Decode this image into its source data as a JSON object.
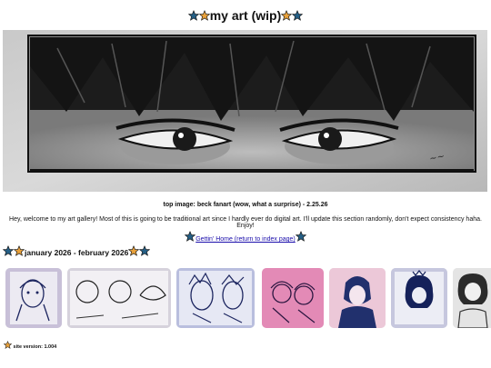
{
  "page": {
    "title": "my art (wip)",
    "caption": "top image: beck fanart (wow, what a surprise) - 2.25.26",
    "intro": "Hey, welcome to my art gallery! Most of this is going to be traditional art since I hardly ever do digital art. I'll update this section randomly, don't expect consistency haha. Enjoy!",
    "home_link": "Gettin' Home (return to index page)",
    "section_title": "january 2026 - february 2026",
    "version": "site version: 1.004"
  },
  "icons": {
    "star_blue": "blue-star-icon",
    "star_orange": "orange-star-icon"
  },
  "colors": {
    "star_blue": "#245f86",
    "star_orange": "#e9a13a",
    "link": "#1a0dab"
  },
  "gallery": [
    {
      "name": "thumb-1"
    },
    {
      "name": "thumb-2"
    },
    {
      "name": "thumb-3"
    },
    {
      "name": "thumb-4"
    },
    {
      "name": "thumb-5"
    },
    {
      "name": "thumb-6"
    },
    {
      "name": "thumb-7"
    }
  ]
}
